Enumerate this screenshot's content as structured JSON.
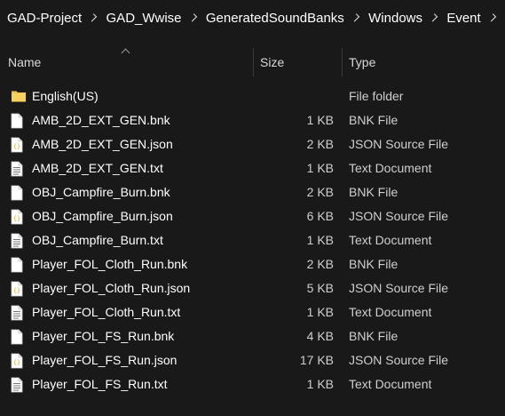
{
  "breadcrumb": [
    "GAD-Project",
    "GAD_Wwise",
    "GeneratedSoundBanks",
    "Windows",
    "Event"
  ],
  "columns": {
    "name": "Name",
    "size": "Size",
    "type": "Type"
  },
  "rows": [
    {
      "name": "English(US)",
      "size": "",
      "type": "File folder",
      "icon": "folder-icon"
    },
    {
      "name": "AMB_2D_EXT_GEN.bnk",
      "size": "1 KB",
      "type": "BNK File",
      "icon": "file-icon"
    },
    {
      "name": "AMB_2D_EXT_GEN.json",
      "size": "2 KB",
      "type": "JSON Source File",
      "icon": "json-file-icon"
    },
    {
      "name": "AMB_2D_EXT_GEN.txt",
      "size": "1 KB",
      "type": "Text Document",
      "icon": "text-file-icon"
    },
    {
      "name": "OBJ_Campfire_Burn.bnk",
      "size": "2 KB",
      "type": "BNK File",
      "icon": "file-icon"
    },
    {
      "name": "OBJ_Campfire_Burn.json",
      "size": "6 KB",
      "type": "JSON Source File",
      "icon": "json-file-icon"
    },
    {
      "name": "OBJ_Campfire_Burn.txt",
      "size": "1 KB",
      "type": "Text Document",
      "icon": "text-file-icon"
    },
    {
      "name": "Player_FOL_Cloth_Run.bnk",
      "size": "2 KB",
      "type": "BNK File",
      "icon": "file-icon"
    },
    {
      "name": "Player_FOL_Cloth_Run.json",
      "size": "5 KB",
      "type": "JSON Source File",
      "icon": "json-file-icon"
    },
    {
      "name": "Player_FOL_Cloth_Run.txt",
      "size": "1 KB",
      "type": "Text Document",
      "icon": "text-file-icon"
    },
    {
      "name": "Player_FOL_FS_Run.bnk",
      "size": "4 KB",
      "type": "BNK File",
      "icon": "file-icon"
    },
    {
      "name": "Player_FOL_FS_Run.json",
      "size": "17 KB",
      "type": "JSON Source File",
      "icon": "json-file-icon"
    },
    {
      "name": "Player_FOL_FS_Run.txt",
      "size": "1 KB",
      "type": "Text Document",
      "icon": "text-file-icon"
    }
  ]
}
